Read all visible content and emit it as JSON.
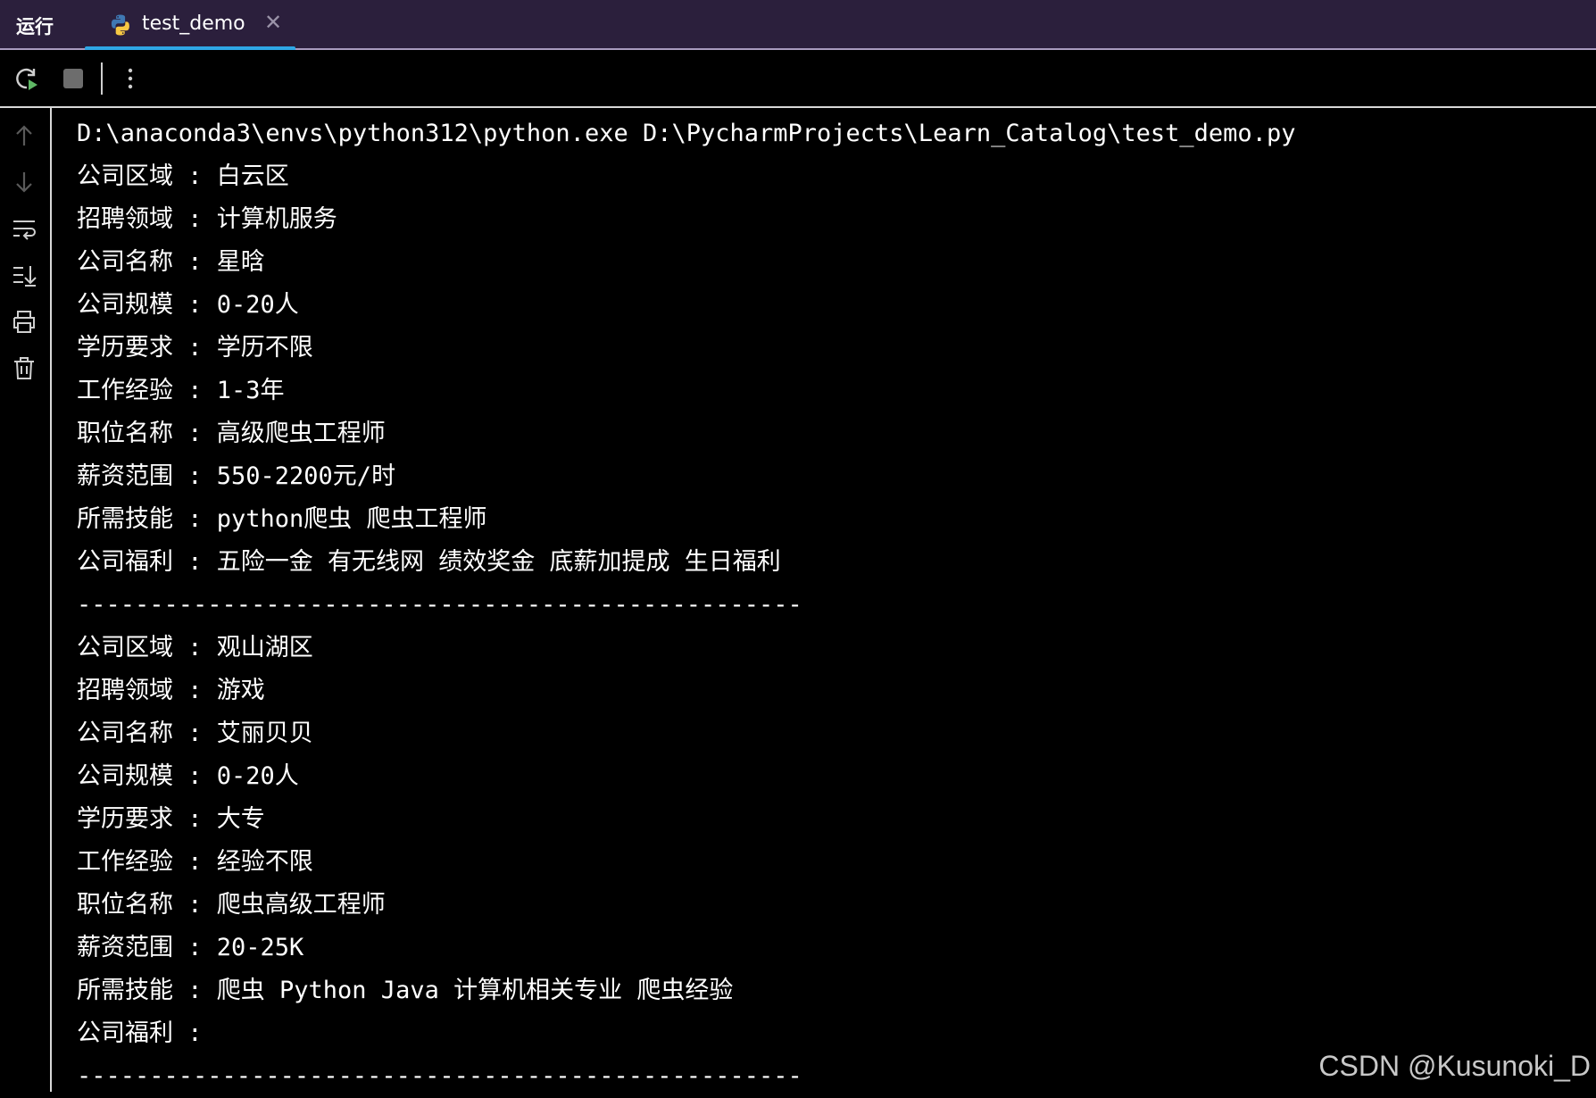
{
  "header": {
    "run_label": "运行",
    "tab": {
      "label": "test_demo",
      "close_glyph": "✕",
      "icon": "python-icon"
    }
  },
  "toolbar": {
    "buttons": [
      {
        "name": "rerun-icon"
      },
      {
        "name": "stop-icon"
      },
      {
        "name": "more-options-icon"
      }
    ]
  },
  "gutter": {
    "buttons": [
      {
        "name": "scroll-up-arrow-icon"
      },
      {
        "name": "scroll-down-arrow-icon"
      },
      {
        "name": "soft-wrap-icon"
      },
      {
        "name": "scroll-to-end-icon"
      },
      {
        "name": "print-icon"
      },
      {
        "name": "trash-icon"
      }
    ]
  },
  "console": {
    "lines": [
      "D:\\anaconda3\\envs\\python312\\python.exe D:\\PycharmProjects\\Learn_Catalog\\test_demo.py",
      "公司区域 : 白云区",
      "招聘领域 : 计算机服务",
      "公司名称 : 星晗",
      "公司规模 : 0-20人",
      "学历要求 : 学历不限",
      "工作经验 : 1-3年",
      "职位名称 : 高级爬虫工程师",
      "薪资范围 : 550-2200元/时",
      "所需技能 : python爬虫 爬虫工程师",
      "公司福利 : 五险一金 有无线网 绩效奖金 底薪加提成 生日福利",
      "--------------------------------------------------",
      "公司区域 : 观山湖区",
      "招聘领域 : 游戏",
      "公司名称 : 艾丽贝贝",
      "公司规模 : 0-20人",
      "学历要求 : 大专",
      "工作经验 : 经验不限",
      "职位名称 : 爬虫高级工程师",
      "薪资范围 : 20-25K",
      "所需技能 : 爬虫 Python Java 计算机相关专业 爬虫经验",
      "公司福利 : ",
      "--------------------------------------------------"
    ]
  },
  "watermark": "CSDN @Kusunoki_D",
  "colors": {
    "tabbar_bg": "#2b1f3c",
    "tab_underline": "#2fa7e6",
    "console_bg": "#000000",
    "console_text": "#ffffff"
  }
}
